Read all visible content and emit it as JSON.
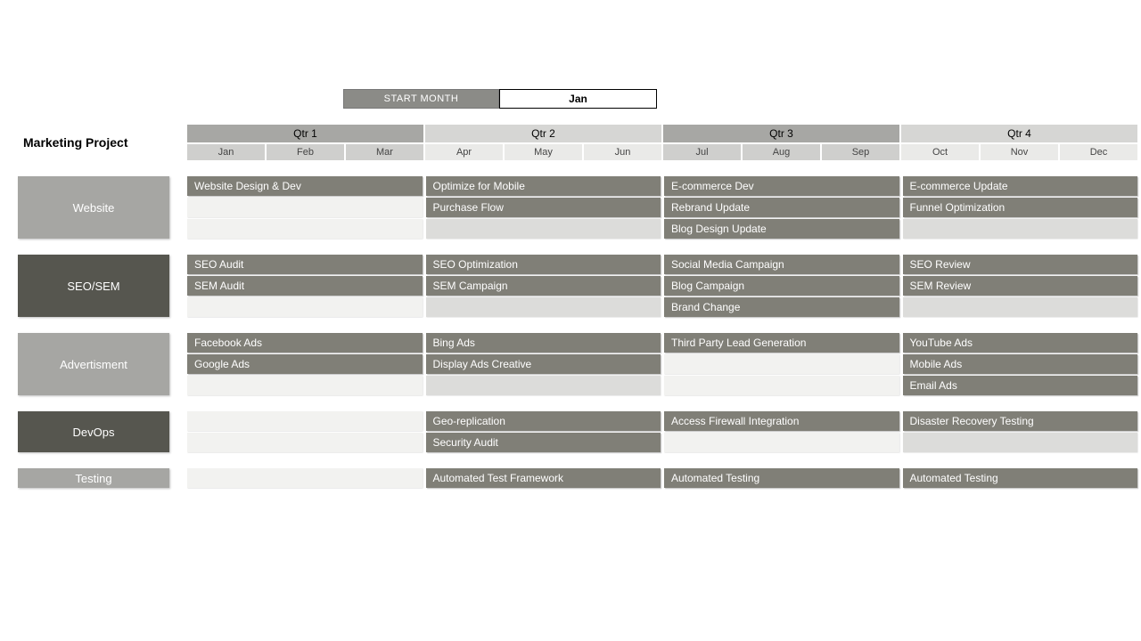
{
  "start": {
    "label": "START MONTH",
    "value": "Jan"
  },
  "title": "Marketing Project",
  "quarters": [
    "Qtr 1",
    "Qtr 2",
    "Qtr 3",
    "Qtr 4"
  ],
  "months": [
    "Jan",
    "Feb",
    "Mar",
    "Apr",
    "May",
    "Jun",
    "Jul",
    "Aug",
    "Sep",
    "Oct",
    "Nov",
    "Dec"
  ],
  "swimlanes": [
    {
      "name": "Website",
      "shade": "light",
      "rows": [
        [
          "Website Design & Dev",
          "Optimize for Mobile",
          "E-commerce Dev",
          "E-commerce Update"
        ],
        [
          "",
          "Purchase Flow",
          "Rebrand Update",
          "Funnel Optimization"
        ],
        [
          "",
          "",
          "Blog Design Update",
          ""
        ]
      ]
    },
    {
      "name": "SEO/SEM",
      "shade": "dark",
      "rows": [
        [
          "SEO Audit",
          "SEO Optimization",
          "Social Media Campaign",
          "SEO Review"
        ],
        [
          "SEM Audit",
          "SEM Campaign",
          "Blog Campaign",
          "SEM Review"
        ],
        [
          "",
          "",
          "Brand Change",
          ""
        ]
      ]
    },
    {
      "name": "Advertisment",
      "shade": "light",
      "rows": [
        [
          "Facebook Ads",
          "Bing Ads",
          "Third Party Lead Generation",
          "YouTube Ads"
        ],
        [
          "Google Ads",
          "Display Ads Creative",
          "",
          "Mobile Ads"
        ],
        [
          "",
          "",
          "",
          "Email Ads"
        ]
      ]
    },
    {
      "name": "DevOps",
      "shade": "dark",
      "rows": [
        [
          "",
          "Geo-replication",
          "Access Firewall Integration",
          "Disaster Recovery Testing"
        ],
        [
          "",
          "Security Audit",
          "",
          ""
        ]
      ]
    },
    {
      "name": "Testing",
      "shade": "light",
      "rows": [
        [
          "",
          "Automated Test Framework",
          "Automated Testing",
          "Automated Testing"
        ]
      ]
    }
  ]
}
